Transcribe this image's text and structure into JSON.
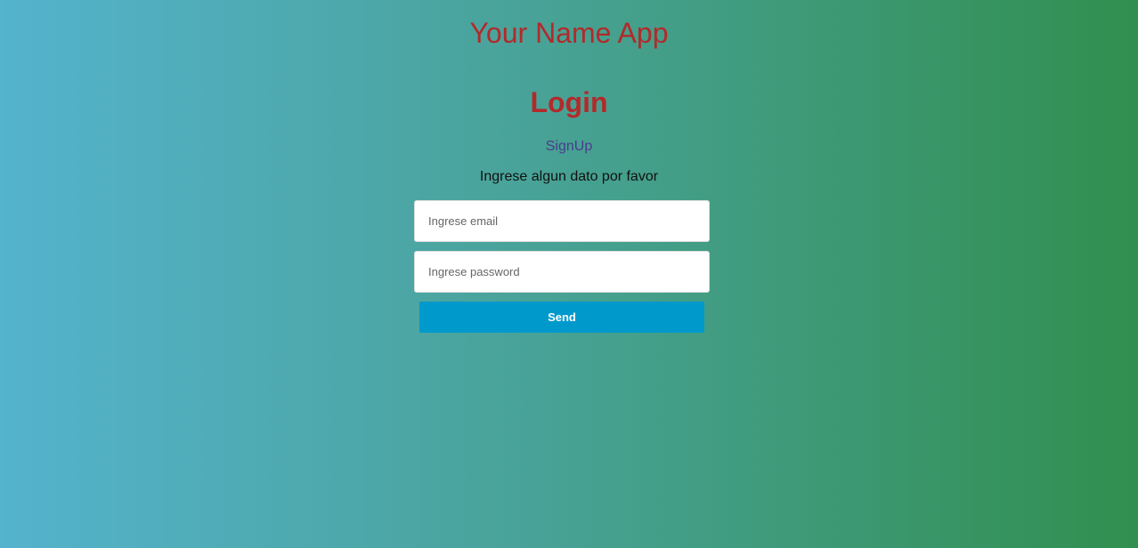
{
  "app": {
    "title": "Your Name App"
  },
  "login": {
    "heading": "Login",
    "signup_link": "SignUp",
    "hint": "Ingrese algun dato por favor",
    "email_placeholder": "Ingrese email",
    "email_value": "",
    "password_placeholder": "Ingrese password",
    "password_value": "",
    "submit_label": "Send"
  },
  "colors": {
    "title": "#b22a2a",
    "link": "#4b3c8c",
    "button": "#0099cc",
    "gradient_left": "#54b3cd",
    "gradient_right": "#318f4f"
  }
}
